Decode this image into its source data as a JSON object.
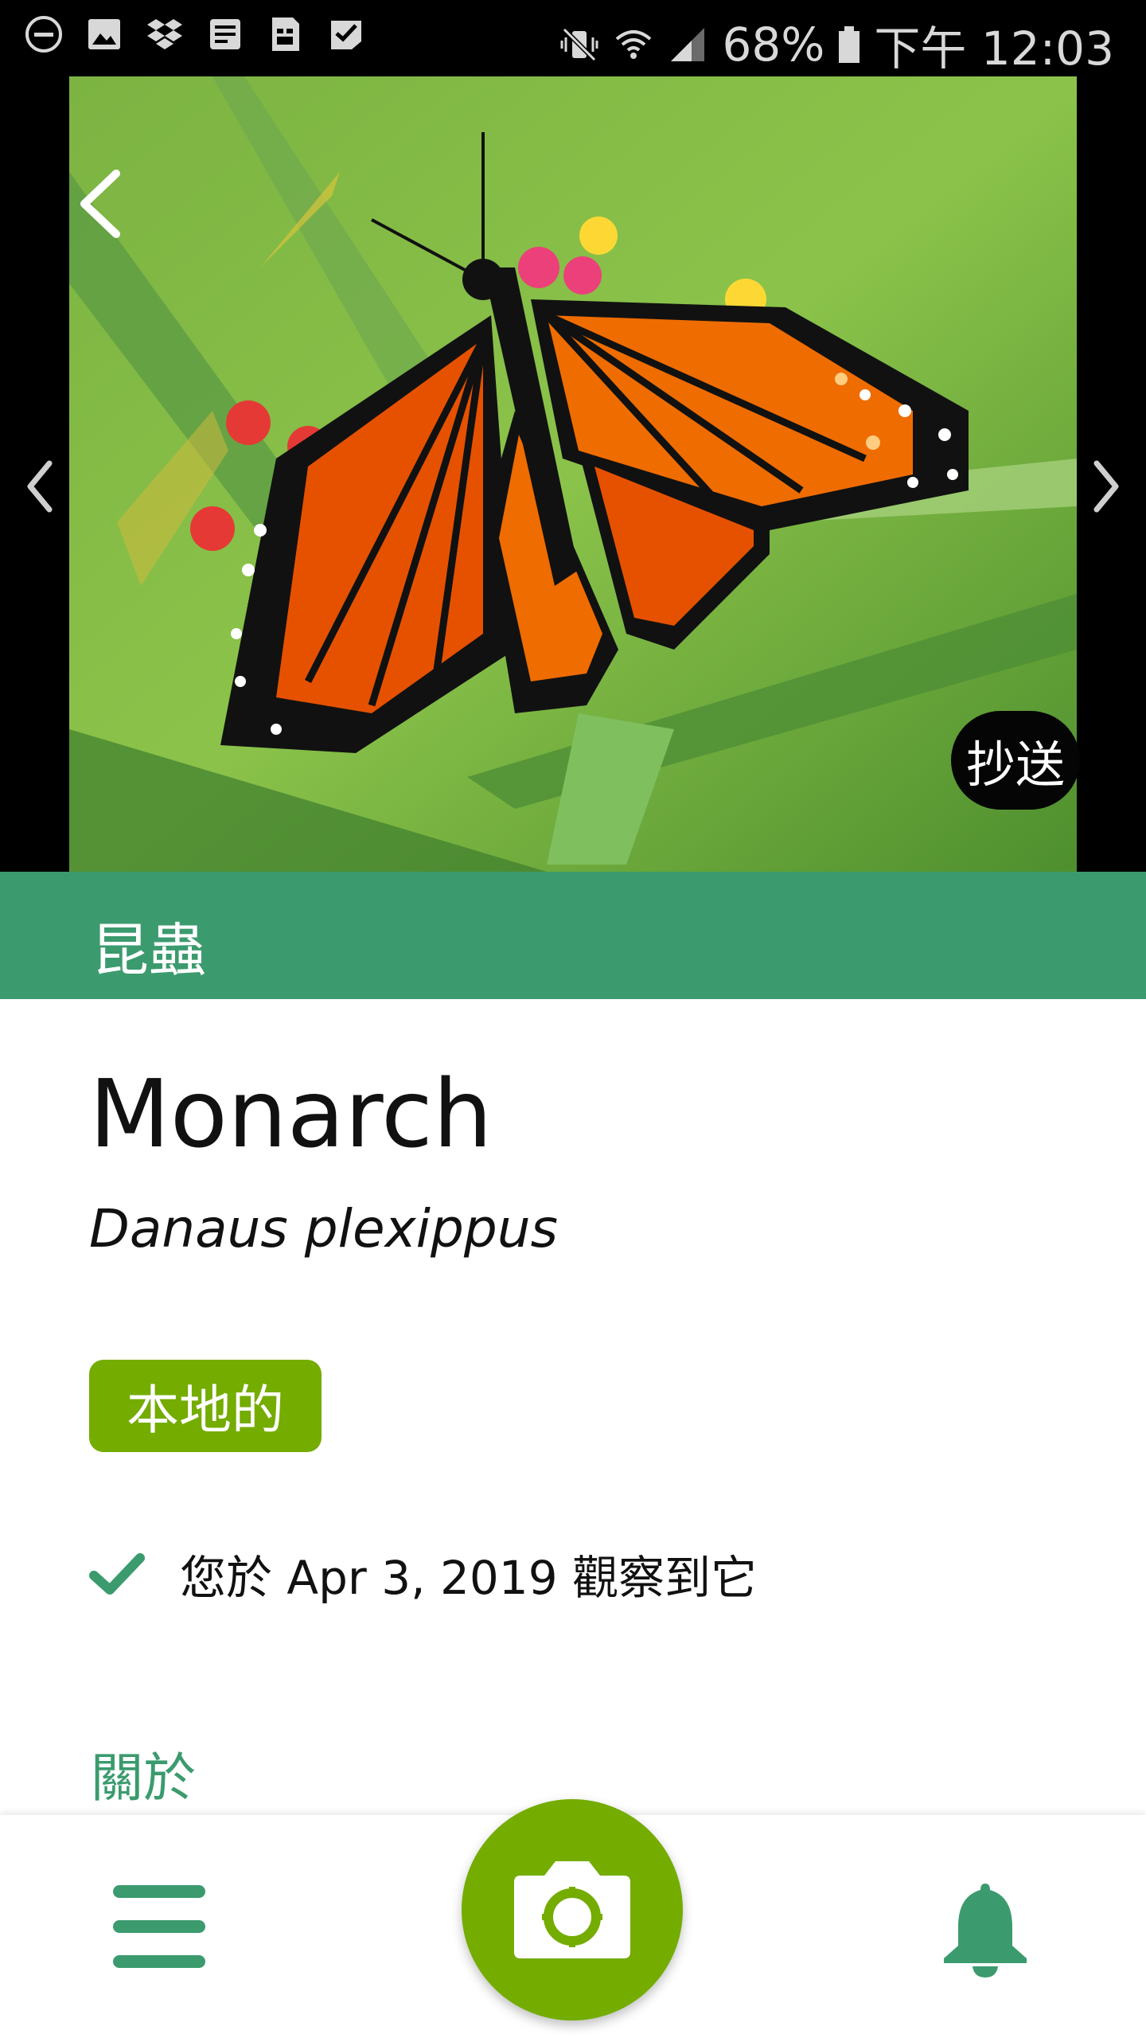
{
  "status_bar": {
    "battery_percent": "68%",
    "time": "下午 12:03",
    "left_icons": [
      "do-not-disturb-icon",
      "gallery-icon",
      "dropbox-icon",
      "document-icon",
      "sim-icon",
      "task-check-icon"
    ],
    "right_icons": [
      "vibrate-mute-icon",
      "wifi-icon",
      "signal-icon",
      "battery-icon"
    ]
  },
  "photo": {
    "cc_label": "抄送"
  },
  "taxon": {
    "category": "昆蟲",
    "common_name": "Monarch",
    "scientific_name": "Danaus plexippus",
    "status_badge": "本地的",
    "observed_text": "您於 Apr 3, 2019 觀察到它",
    "about_heading": "關於"
  },
  "colors": {
    "brand_green": "#3b9b6e",
    "native_green": "#74ac00"
  },
  "bottom_nav": {
    "icons": [
      "menu-icon",
      "camera-icon",
      "bell-icon"
    ]
  }
}
